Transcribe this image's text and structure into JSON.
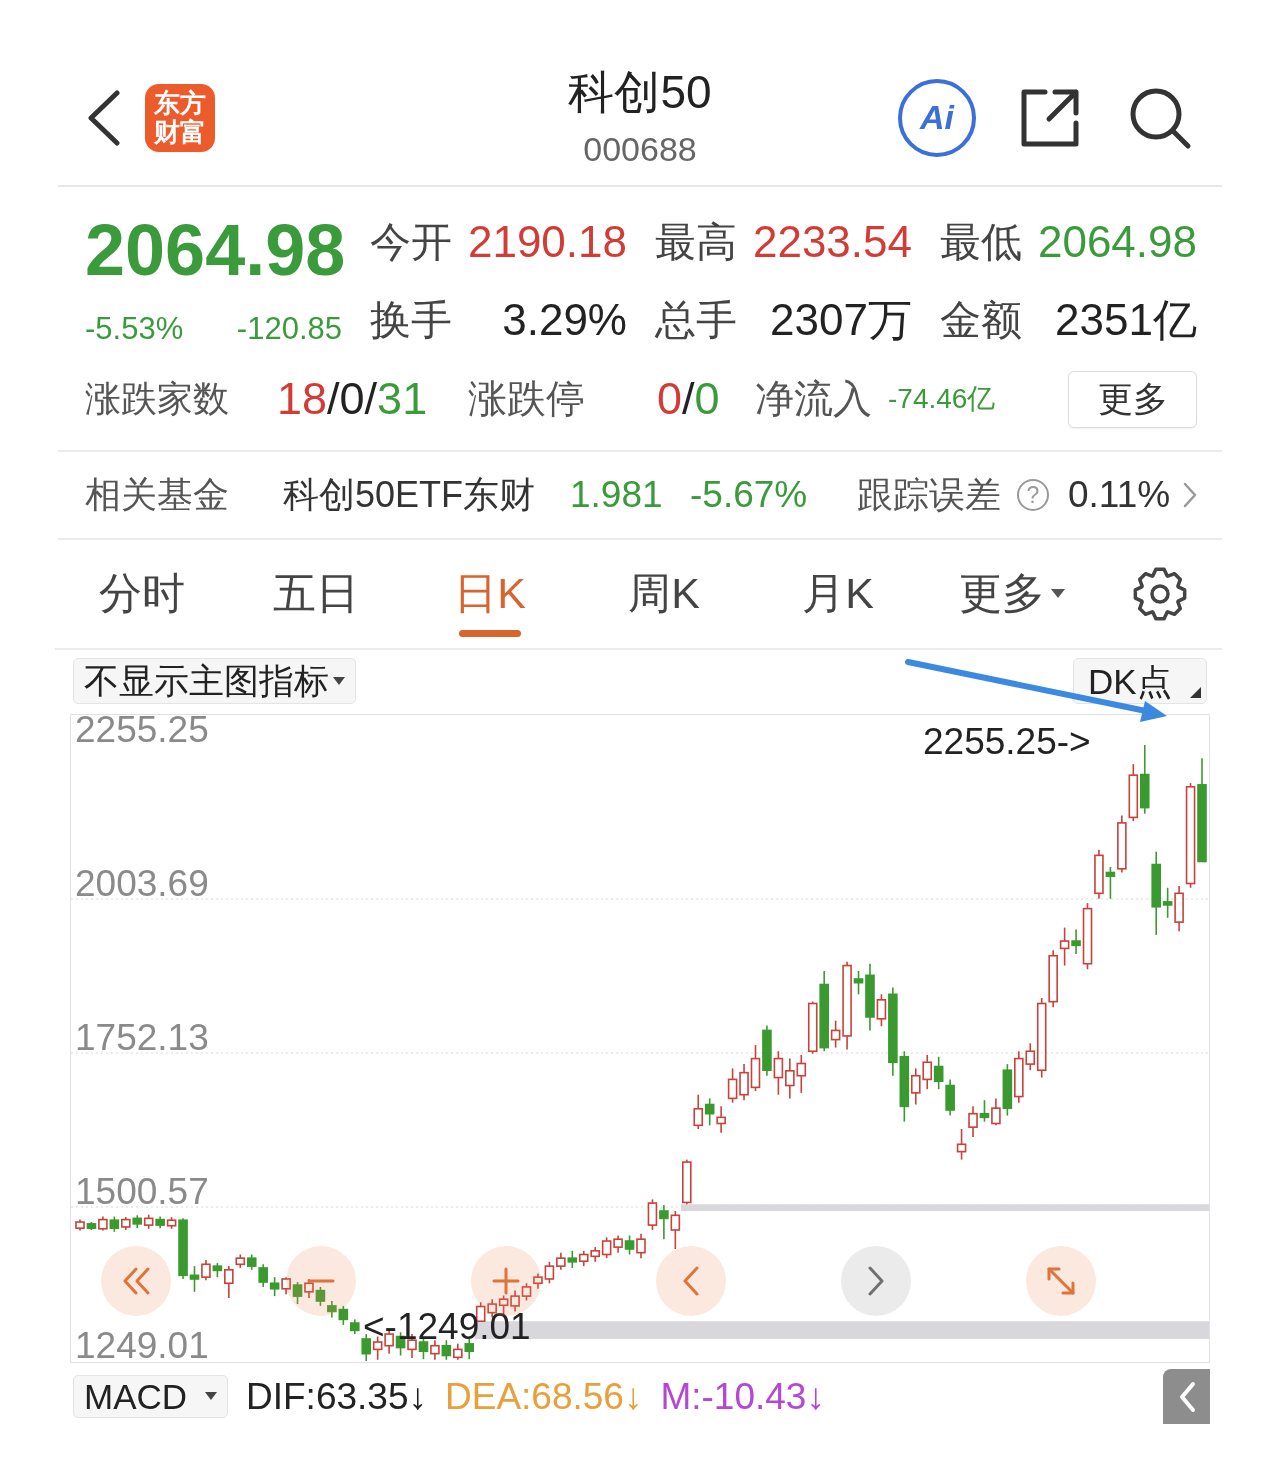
{
  "header": {
    "logo": [
      "东方",
      "财富"
    ],
    "title": "科创50",
    "code": "000688",
    "ai_label": "Ai"
  },
  "quote": {
    "price": "2064.98",
    "falling": true,
    "change_pct": "-5.53%",
    "change": "-120.85",
    "stats": [
      {
        "label": "今开",
        "value": "2190.18",
        "color": "#d23c36"
      },
      {
        "label": "最高",
        "value": "2233.54",
        "color": "#d23c36"
      },
      {
        "label": "最低",
        "value": "2064.98",
        "color": "#3b9a3b"
      },
      {
        "label": "换手",
        "value": "3.29%",
        "color": "#222222"
      },
      {
        "label": "总手",
        "value": "2307万",
        "color": "#222222"
      },
      {
        "label": "金额",
        "value": "2351亿",
        "color": "#222222"
      }
    ]
  },
  "market": {
    "breadth_label": "涨跌家数",
    "breadth": [
      {
        "text": "18",
        "color": "#d23c36"
      },
      {
        "text": "/0/",
        "color": "#222222"
      },
      {
        "text": "31",
        "color": "#3b9a3b"
      }
    ],
    "limit_label": "涨跌停",
    "limit": [
      {
        "text": "0",
        "color": "#d23c36"
      },
      {
        "text": "/",
        "color": "#222222"
      },
      {
        "text": "0",
        "color": "#3b9a3b"
      }
    ],
    "inflow_label": "净流入",
    "inflow": "-74.46亿",
    "inflow_falling": true,
    "more_button": "更多"
  },
  "fund": {
    "label": "相关基金",
    "name": "科创50ETF东财",
    "price": "1.981",
    "change": "-5.67%",
    "falling": true,
    "error_label": "跟踪误差",
    "help": "?",
    "error": "0.11%"
  },
  "tabs": [
    {
      "label": "分时",
      "selected": false,
      "kind": "tab"
    },
    {
      "label": "五日",
      "selected": false,
      "kind": "tab"
    },
    {
      "label": "日K",
      "selected": true,
      "kind": "tab"
    },
    {
      "label": "周K",
      "selected": false,
      "kind": "tab"
    },
    {
      "label": "月K",
      "selected": false,
      "kind": "tab"
    },
    {
      "label": "更多",
      "selected": false,
      "kind": "menu"
    }
  ],
  "chart": {
    "indicator": "不显示主图指标",
    "dk_button": "DK点",
    "high_label": "2255.25->",
    "low_label": "<-1249.01",
    "chart_data": {
      "type": "candlestick",
      "ylim": [
        1249.01,
        2304.26
      ],
      "grid": true,
      "yticks": [
        {
          "value": 2255.25,
          "label": "2255.25"
        },
        {
          "value": 2003.69,
          "label": "2003.69"
        },
        {
          "value": 1752.13,
          "label": "1752.13"
        },
        {
          "value": 1500.57,
          "label": "1500.57"
        },
        {
          "value": 1249.01,
          "label": "1249.01"
        }
      ],
      "ohlc": [
        [
          1466,
          1480,
          1462,
          1476
        ],
        [
          1473,
          1476,
          1463,
          1466
        ],
        [
          1465,
          1485,
          1462,
          1480
        ],
        [
          1479,
          1485,
          1460,
          1466
        ],
        [
          1468,
          1484,
          1463,
          1480
        ],
        [
          1482,
          1487,
          1466,
          1473
        ],
        [
          1471,
          1488,
          1465,
          1482
        ],
        [
          1480,
          1485,
          1466,
          1471
        ],
        [
          1470,
          1484,
          1465,
          1479
        ],
        [
          1479,
          1482,
          1383,
          1389
        ],
        [
          1389,
          1404,
          1362,
          1383
        ],
        [
          1386,
          1414,
          1381,
          1407
        ],
        [
          1404,
          1409,
          1386,
          1397
        ],
        [
          1376,
          1404,
          1352,
          1398
        ],
        [
          1407,
          1423,
          1401,
          1417
        ],
        [
          1417,
          1423,
          1398,
          1404
        ],
        [
          1401,
          1407,
          1370,
          1378
        ],
        [
          1376,
          1386,
          1355,
          1367
        ],
        [
          1367,
          1386,
          1358,
          1383
        ],
        [
          1373,
          1378,
          1342,
          1355
        ],
        [
          1362,
          1383,
          1352,
          1376
        ],
        [
          1364,
          1370,
          1339,
          1347
        ],
        [
          1339,
          1347,
          1320,
          1330
        ],
        [
          1333,
          1339,
          1308,
          1317
        ],
        [
          1311,
          1317,
          1293,
          1299
        ],
        [
          1285,
          1293,
          1249.01,
          1261
        ],
        [
          1268,
          1289,
          1251,
          1280
        ],
        [
          1274,
          1300,
          1261,
          1293
        ],
        [
          1289,
          1296,
          1258,
          1271
        ],
        [
          1268,
          1293,
          1254,
          1283
        ],
        [
          1280,
          1286,
          1252,
          1265
        ],
        [
          1261,
          1283,
          1251,
          1274
        ],
        [
          1274,
          1283,
          1251,
          1258
        ],
        [
          1255,
          1277,
          1251,
          1268
        ],
        [
          1277,
          1285,
          1252,
          1265
        ],
        [
          1314,
          1345,
          1314,
          1338
        ],
        [
          1328,
          1350,
          1320,
          1342
        ],
        [
          1340,
          1356,
          1322,
          1350
        ],
        [
          1339,
          1364,
          1330,
          1355
        ],
        [
          1355,
          1376,
          1348,
          1370
        ],
        [
          1376,
          1392,
          1367,
          1386
        ],
        [
          1383,
          1411,
          1376,
          1404
        ],
        [
          1404,
          1426,
          1398,
          1417
        ],
        [
          1417,
          1429,
          1401,
          1411
        ],
        [
          1412,
          1429,
          1404,
          1423
        ],
        [
          1420,
          1435,
          1411,
          1429
        ],
        [
          1423,
          1451,
          1417,
          1445
        ],
        [
          1435,
          1454,
          1426,
          1448
        ],
        [
          1445,
          1454,
          1423,
          1432
        ],
        [
          1426,
          1457,
          1417,
          1448
        ],
        [
          1471,
          1513,
          1463,
          1507
        ],
        [
          1494,
          1504,
          1448,
          1482
        ],
        [
          1463,
          1494,
          1432,
          1487
        ],
        [
          1508,
          1578,
          1505,
          1574
        ],
        [
          1634,
          1684,
          1628,
          1661
        ],
        [
          1668,
          1678,
          1634,
          1653
        ],
        [
          1637,
          1665,
          1622,
          1647
        ],
        [
          1678,
          1727,
          1671,
          1709
        ],
        [
          1684,
          1734,
          1675,
          1720
        ],
        [
          1696,
          1765,
          1690,
          1743
        ],
        [
          1789,
          1797,
          1715,
          1724
        ],
        [
          1712,
          1755,
          1684,
          1743
        ],
        [
          1699,
          1743,
          1678,
          1723
        ],
        [
          1715,
          1749,
          1687,
          1735
        ],
        [
          1755,
          1836,
          1751,
          1833
        ],
        [
          1864,
          1886,
          1755,
          1761
        ],
        [
          1774,
          1805,
          1761,
          1789
        ],
        [
          1780,
          1901,
          1758,
          1895
        ],
        [
          1873,
          1886,
          1848,
          1867
        ],
        [
          1879,
          1898,
          1789,
          1811
        ],
        [
          1808,
          1848,
          1796,
          1839
        ],
        [
          1848,
          1859,
          1715,
          1737
        ],
        [
          1746,
          1755,
          1640,
          1665
        ],
        [
          1687,
          1727,
          1668,
          1715
        ],
        [
          1709,
          1749,
          1693,
          1737
        ],
        [
          1730,
          1746,
          1693,
          1706
        ],
        [
          1699,
          1709,
          1650,
          1659
        ],
        [
          1591,
          1628,
          1578,
          1603
        ],
        [
          1631,
          1665,
          1615,
          1653
        ],
        [
          1653,
          1675,
          1640,
          1647
        ],
        [
          1637,
          1678,
          1634,
          1662
        ],
        [
          1724,
          1734,
          1650,
          1662
        ],
        [
          1681,
          1755,
          1671,
          1743
        ],
        [
          1734,
          1768,
          1724,
          1755
        ],
        [
          1724,
          1842,
          1712,
          1833
        ],
        [
          1836,
          1920,
          1827,
          1911
        ],
        [
          1923,
          1957,
          1895,
          1935
        ],
        [
          1935,
          1954,
          1914,
          1928
        ],
        [
          1898,
          1997,
          1889,
          1988
        ],
        [
          2013,
          2084,
          2004,
          2075
        ],
        [
          2047,
          2056,
          2004,
          2041
        ],
        [
          2053,
          2140,
          2047,
          2128
        ],
        [
          2137,
          2224,
          2131,
          2206
        ],
        [
          2207,
          2255.25,
          2143,
          2153
        ],
        [
          2060,
          2081,
          1945,
          1991
        ],
        [
          1999,
          2022,
          1973,
          1994
        ],
        [
          1966,
          2025,
          1951,
          2013
        ],
        [
          2029,
          2193,
          2022,
          2187
        ],
        [
          2190.18,
          2233.54,
          2064.98,
          2064.98
        ]
      ]
    },
    "controls": [
      {
        "kind": "first",
        "disabled": false
      },
      {
        "kind": "zoom_out",
        "disabled": false
      },
      {
        "kind": "zoom_in",
        "disabled": false
      },
      {
        "kind": "back",
        "disabled": false
      },
      {
        "kind": "forward",
        "disabled": true
      },
      {
        "kind": "expand",
        "disabled": false
      }
    ]
  },
  "indicator": {
    "select": "MACD",
    "values": [
      {
        "text": "DIF:63.35↓",
        "color": "#222222"
      },
      {
        "text": "DEA:68.56↓",
        "color": "#e8a03c"
      },
      {
        "text": "M:-10.43↓",
        "color": "#b447d4"
      }
    ]
  }
}
